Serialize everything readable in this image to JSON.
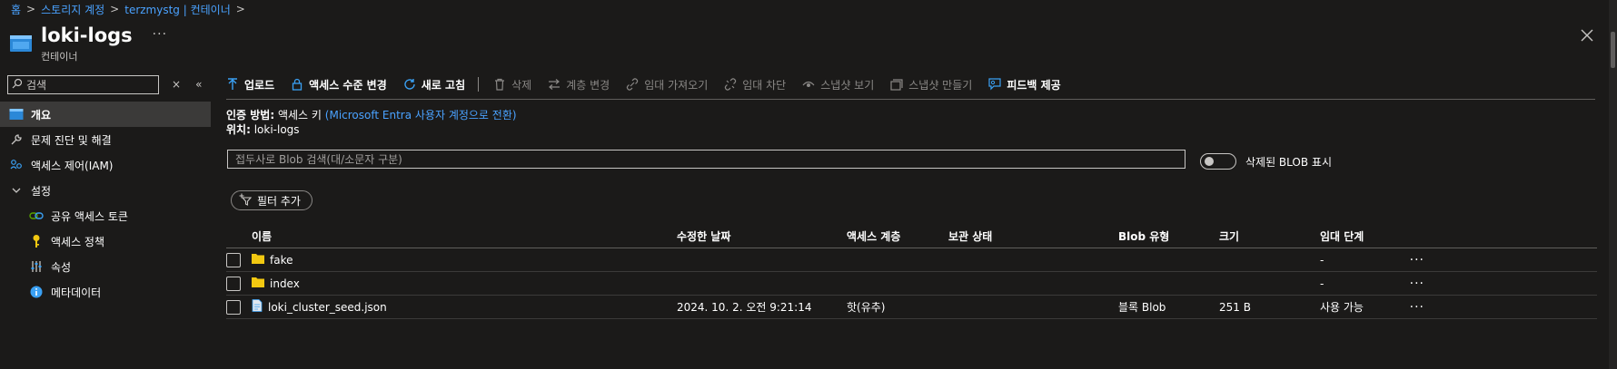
{
  "breadcrumb": [
    {
      "label": "홈"
    },
    {
      "label": "스토리지 계정"
    },
    {
      "label": "terzmystg | 컨테이너"
    }
  ],
  "header": {
    "title": "loki-logs",
    "subtitle": "컨테이너",
    "more": "···",
    "close": "✕"
  },
  "sidebar": {
    "search_placeholder": "검색",
    "clear": "×",
    "collapse": "«",
    "items": [
      {
        "label": "개요",
        "icon": "container-icon"
      },
      {
        "label": "문제 진단 및 해결",
        "icon": "wrench-icon"
      },
      {
        "label": "액세스 제어(IAM)",
        "icon": "people-icon"
      },
      {
        "label": "설정",
        "icon": "chevron-down-icon"
      },
      {
        "label": "공유 액세스 토큰",
        "icon": "link-icon"
      },
      {
        "label": "액세스 정책",
        "icon": "key-icon"
      },
      {
        "label": "속성",
        "icon": "sliders-icon"
      },
      {
        "label": "메타데이터",
        "icon": "info-icon"
      }
    ]
  },
  "toolbar": {
    "upload": "업로드",
    "change_access_level": "액세스 수준 변경",
    "refresh": "새로 고침",
    "delete": "삭제",
    "change_tier": "계층 변경",
    "acquire_lease": "임대 가져오기",
    "break_lease": "임대 차단",
    "view_snapshots": "스냅샷 보기",
    "create_snapshot": "스냅샷 만들기",
    "feedback": "피드백 제공"
  },
  "auth": {
    "method_label": "인증 방법:",
    "method_value": "액세스 키",
    "switch_link": "(Microsoft Entra 사용자 계정으로 전환)",
    "location_label": "위치:",
    "location_value": "loki-logs"
  },
  "search": {
    "placeholder": "접두사로 Blob 검색(대/소문자 구분)"
  },
  "show_deleted": {
    "label": "삭제된 BLOB 표시",
    "on": false
  },
  "filter": {
    "label": "필터 추가"
  },
  "table": {
    "columns": [
      "이름",
      "수정한 날짜",
      "액세스 계층",
      "보관 상태",
      "Blob 유형",
      "크기",
      "임대 단계"
    ],
    "rows": [
      {
        "icon": "folder-icon",
        "name": "fake",
        "modified": "",
        "tier": "",
        "archive": "",
        "type": "",
        "size": "",
        "lease": "-"
      },
      {
        "icon": "folder-icon",
        "name": "index",
        "modified": "",
        "tier": "",
        "archive": "",
        "type": "",
        "size": "",
        "lease": "-"
      },
      {
        "icon": "file-icon",
        "name": "loki_cluster_seed.json",
        "modified": "2024. 10. 2. 오전 9:21:14",
        "tier": "핫(유추)",
        "archive": "",
        "type": "블록 Blob",
        "size": "251 B",
        "lease": "사용 가능"
      }
    ],
    "row_more": "···"
  },
  "colors": {
    "background": "#1b1a19",
    "link": "#4aa2ff",
    "accent_icon": "#3aa0f3",
    "folder": "#f2c811"
  }
}
